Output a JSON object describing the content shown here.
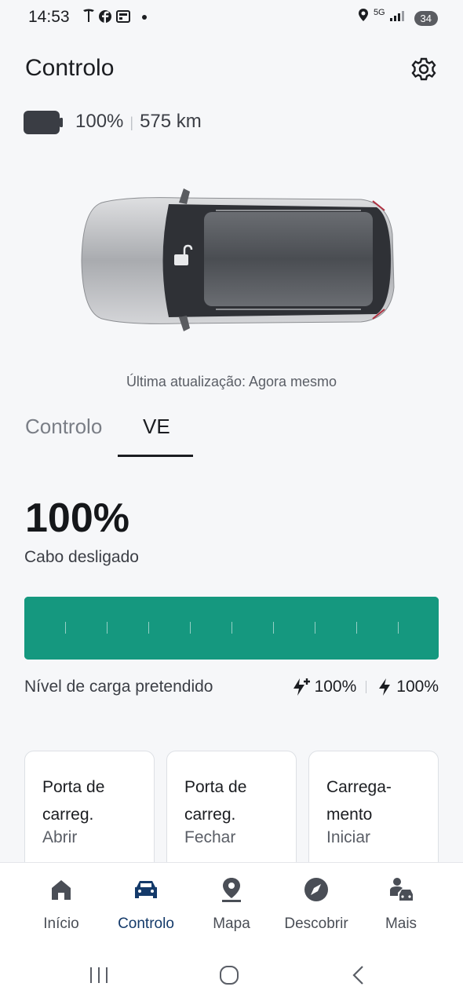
{
  "status_bar": {
    "time": "14:53",
    "notification_icons": [
      "tesla-icon",
      "facebook-icon",
      "news-icon",
      "dot-icon"
    ],
    "network": "5G",
    "battery": "34"
  },
  "header": {
    "title": "Controlo"
  },
  "vehicle": {
    "battery_percent": "100%",
    "range": "575 km"
  },
  "last_update": "Última atualização: Agora mesmo",
  "tabs": [
    {
      "label": "Controlo",
      "active": false
    },
    {
      "label": "VE",
      "active": true
    }
  ],
  "ev": {
    "charge_level": "100%",
    "charge_fraction": 1.0,
    "cable_status": "Cabo desligado",
    "target_label": "Nível de carga pretendido",
    "target_fast": "100%",
    "target_normal": "100%"
  },
  "cards": [
    {
      "title": "Porta de carreg.",
      "action": "Abrir"
    },
    {
      "title": "Porta de carreg.",
      "action": "Fechar"
    },
    {
      "title": "Carrega-mento",
      "action": "Iniciar"
    }
  ],
  "bottom_nav": [
    {
      "label": "Início",
      "icon": "home-icon"
    },
    {
      "label": "Controlo",
      "icon": "car-icon",
      "active": true
    },
    {
      "label": "Mapa",
      "icon": "map-pin-icon"
    },
    {
      "label": "Descobrir",
      "icon": "compass-icon"
    },
    {
      "label": "Mais",
      "icon": "person-car-icon"
    }
  ],
  "colors": {
    "accent_green": "#15987f",
    "nav_active": "#143a6a"
  }
}
